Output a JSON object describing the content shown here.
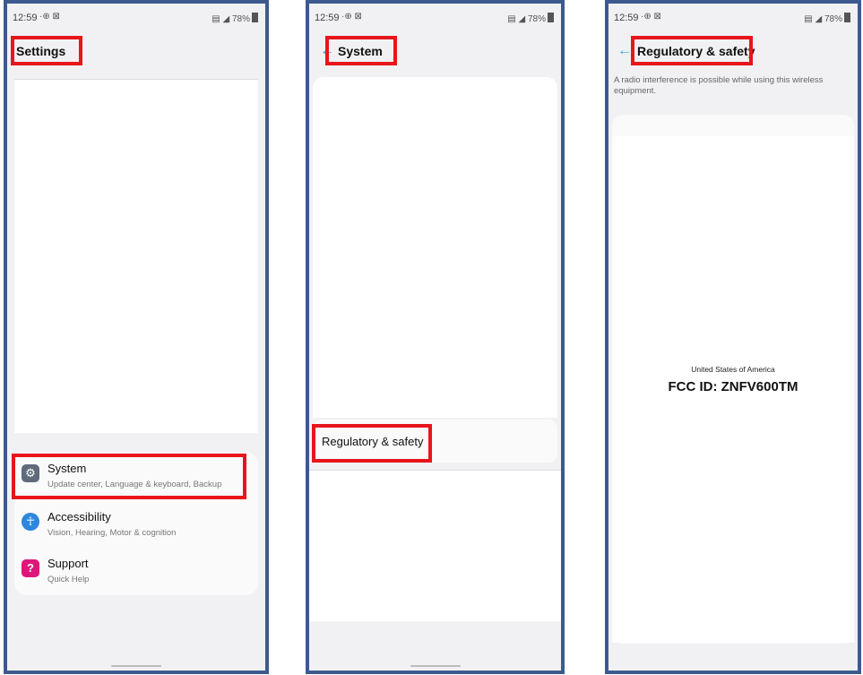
{
  "status": {
    "time": "12:59",
    "left_icons": "·⊕ ⊠",
    "right": "78%"
  },
  "screen1": {
    "title": "Settings",
    "items": [
      {
        "label": "System",
        "subtitle": "Update center, Language & keyboard, Backup",
        "icon": "gear-icon",
        "icon_color": "#5f6b7c"
      },
      {
        "label": "Accessibility",
        "subtitle": "Vision, Hearing, Motor & cognition",
        "icon": "accessibility-icon",
        "icon_color": "#2e86de"
      },
      {
        "label": "Support",
        "subtitle": "Quick Help",
        "icon": "help-icon",
        "icon_color": "#e0157a"
      }
    ]
  },
  "screen2": {
    "title": "System",
    "item_label": "Regulatory & safety"
  },
  "screen3": {
    "title": "Regulatory & safety",
    "description": "A radio interference is possible while using this wireless equipment.",
    "country": "United States of America",
    "fcc_id": "FCC ID: ZNFV600TM"
  },
  "colors": {
    "frame": "#3d5a8f",
    "highlight": "#e8151b",
    "accent": "#3aa0e0"
  }
}
